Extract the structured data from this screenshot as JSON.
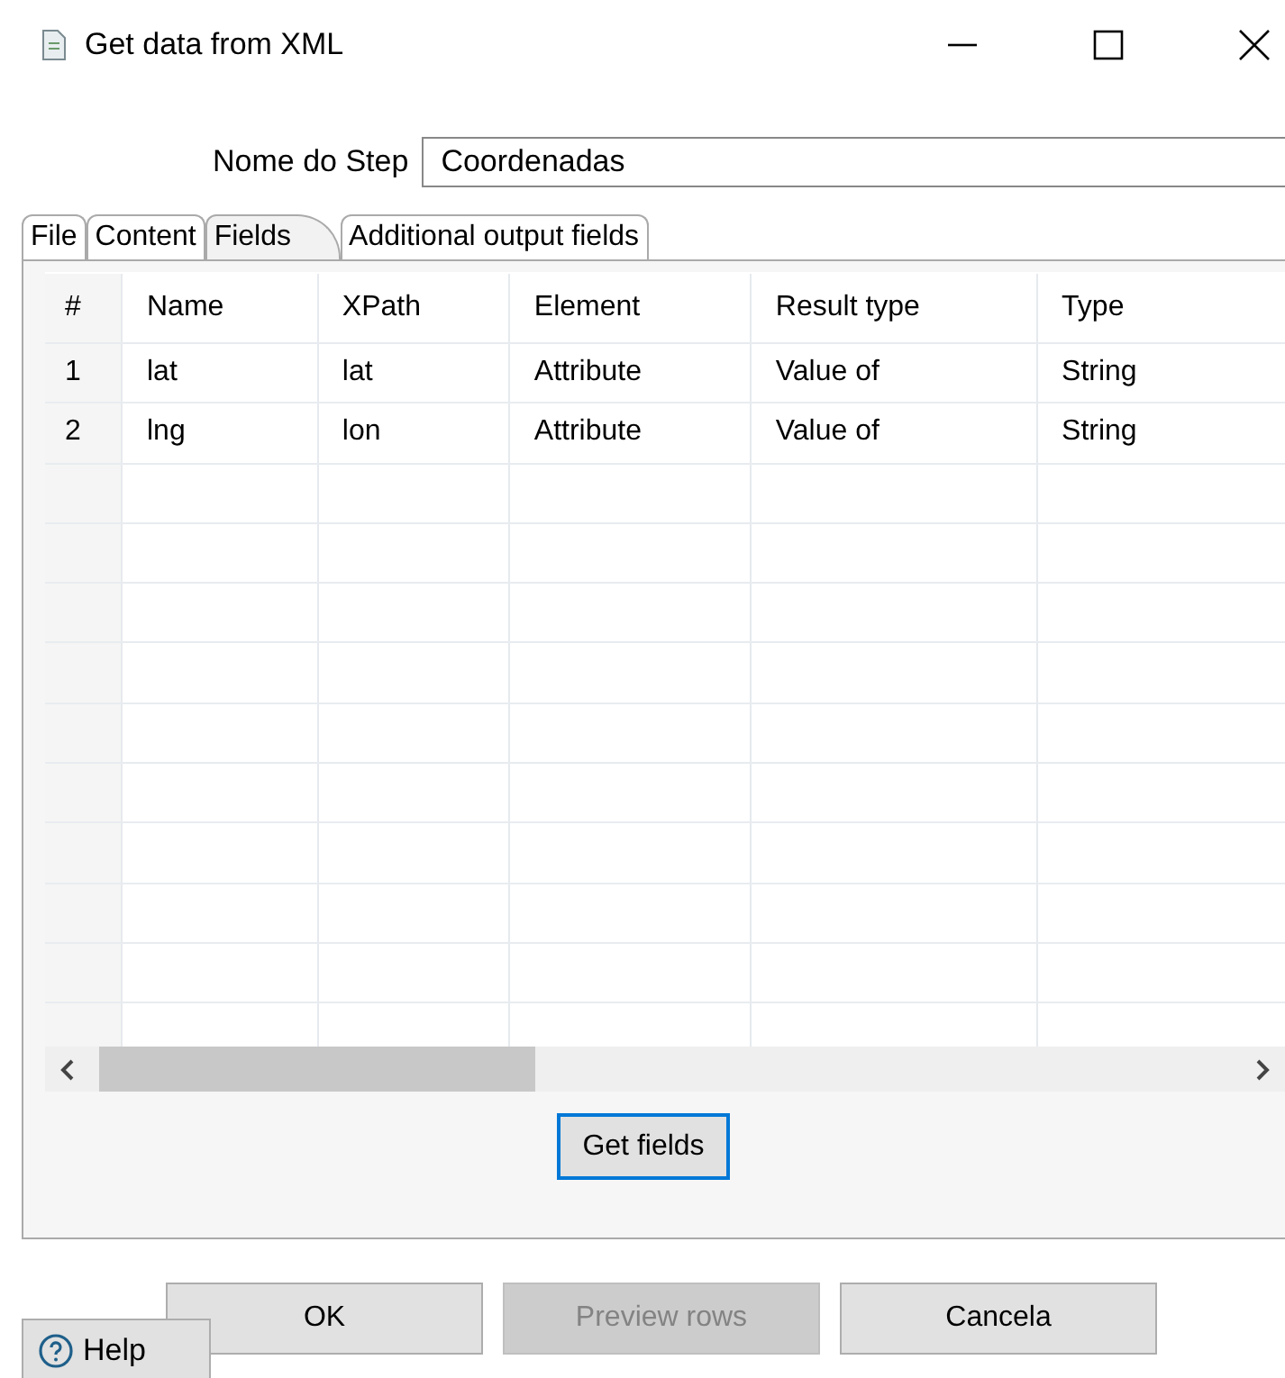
{
  "window": {
    "title": "Get data from XML"
  },
  "step_name": {
    "label": "Nome do Step",
    "value": "Coordenadas"
  },
  "tabs": [
    {
      "label": "File",
      "selected": false
    },
    {
      "label": "Content",
      "selected": false
    },
    {
      "label": "Fields",
      "selected": true
    },
    {
      "label": "Additional output fields",
      "selected": false
    }
  ],
  "table": {
    "columns": [
      "#",
      "Name",
      "XPath",
      "Element",
      "Result type",
      "Type"
    ],
    "rows": [
      [
        "1",
        "lat",
        "lat",
        "Attribute",
        "Value of",
        "String"
      ],
      [
        "2",
        "lng",
        "lon",
        "Attribute",
        "Value of",
        "String"
      ]
    ]
  },
  "get_fields_button": {
    "label": "Get fields",
    "focused": true
  },
  "buttons": [
    {
      "label": "OK",
      "disabled": false
    },
    {
      "label": "Preview rows",
      "disabled": true
    },
    {
      "label": "Cancela",
      "disabled": false
    }
  ],
  "help_button": {
    "label": "Help"
  }
}
